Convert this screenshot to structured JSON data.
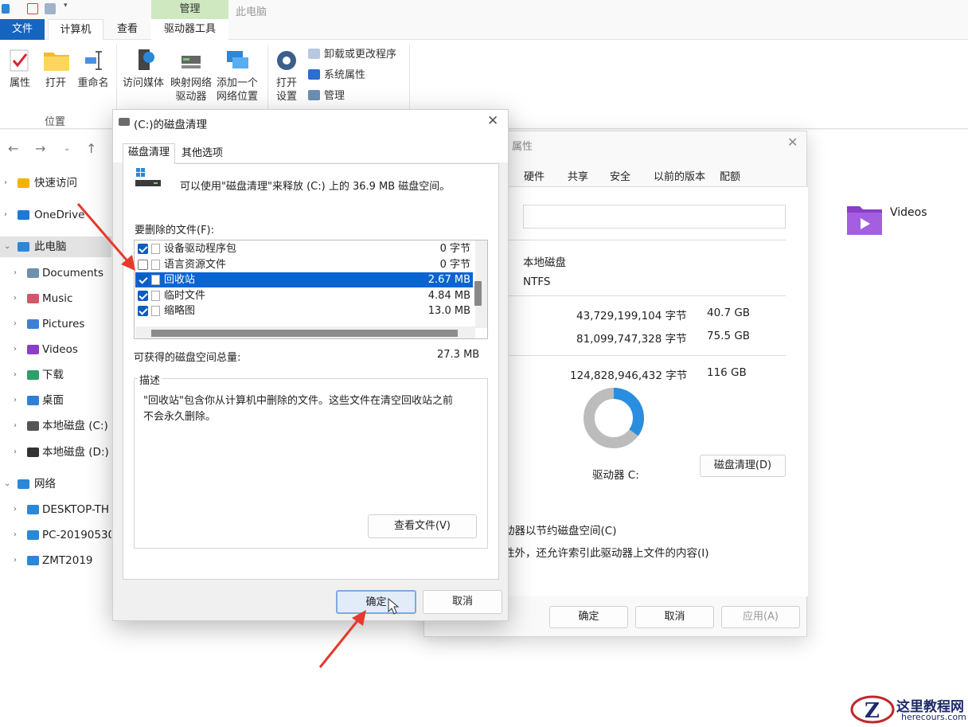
{
  "explorer": {
    "window_title": "此电脑",
    "context_tab": "管理",
    "tabs": {
      "file": "文件",
      "computer": "计算机",
      "view": "查看",
      "drive_tools": "驱动器工具"
    },
    "ribbon": {
      "properties": "属性",
      "open": "打开",
      "rename": "重命名",
      "access_media_l1": "访问媒体",
      "map_drive_l1": "映射网络",
      "map_drive_l2": "驱动器",
      "add_location_l1": "添加一个",
      "add_location_l2": "网络位置",
      "open_settings_l1": "打开",
      "open_settings_l2": "设置",
      "uninstall": "卸载或更改程序",
      "system_props": "系统属性",
      "manage": "管理",
      "group_location": "位置"
    },
    "sidebar": [
      {
        "label": "快速访问",
        "chevron": "›",
        "icon": "star-icon",
        "color": "#f2b300"
      },
      {
        "label": "OneDrive",
        "chevron": "›",
        "icon": "cloud-icon",
        "color": "#1e78d7"
      },
      {
        "label": "此电脑",
        "chevron": "⌄",
        "icon": "pc-icon",
        "color": "#2b87d8"
      },
      {
        "label": "Documents",
        "chevron": "›",
        "icon": "documents-folder-icon",
        "color": "#6d8fb0"
      },
      {
        "label": "Music",
        "chevron": "›",
        "icon": "music-folder-icon",
        "color": "#d4566b"
      },
      {
        "label": "Pictures",
        "chevron": "›",
        "icon": "pictures-folder-icon",
        "color": "#3d7fd6"
      },
      {
        "label": "Videos",
        "chevron": "›",
        "icon": "videos-folder-icon",
        "color": "#8a3fc8"
      },
      {
        "label": "下载",
        "chevron": "›",
        "icon": "downloads-folder-icon",
        "color": "#2e9e6b"
      },
      {
        "label": "桌面",
        "chevron": "›",
        "icon": "desktop-folder-icon",
        "color": "#2f7fd8"
      },
      {
        "label": "本地磁盘 (C:)",
        "chevron": "›",
        "icon": "drive-c-icon",
        "color": "#555555"
      },
      {
        "label": "本地磁盘 (D:)",
        "chevron": "›",
        "icon": "drive-d-icon",
        "color": "#333333"
      },
      {
        "label": "网络",
        "chevron": "⌄",
        "icon": "network-icon",
        "color": "#2b87d8"
      },
      {
        "label": "DESKTOP-TH",
        "chevron": "›",
        "icon": "computer-icon",
        "color": "#2b87d8"
      },
      {
        "label": "PC-20190530",
        "chevron": "›",
        "icon": "computer-icon",
        "color": "#2b87d8"
      },
      {
        "label": "ZMT2019",
        "chevron": "›",
        "icon": "computer-icon",
        "color": "#2b87d8"
      }
    ],
    "content": {
      "videos_label": "Videos"
    }
  },
  "properties_dialog": {
    "title": "属性",
    "tabs": [
      "硬件",
      "共享",
      "安全",
      "以前的版本",
      "配额"
    ],
    "type_value": "本地磁盘",
    "fs_value": "NTFS",
    "used_bytes": "43,729,199,104 字节",
    "used_gb": "40.7 GB",
    "free_bytes": "81,099,747,328 字节",
    "free_gb": "75.5 GB",
    "used_suffix": ":",
    "free_suffix": ":",
    "capacity_bytes": "124,828,946,432 字节",
    "capacity_gb": "116 GB",
    "drive_label": "驱动器 C:",
    "cleanup_button": "磁盘清理(D)",
    "compress_text": "动器以节约磁盘空间(C)",
    "index_text": "性外，还允许索引此驱动器上文件的内容(I)",
    "ok": "确定",
    "cancel": "取消",
    "apply": "应用(A)",
    "used_fraction": 0.35,
    "used_color": "#2a8ee0",
    "free_color": "#bcbcbc"
  },
  "cleanup_dialog": {
    "title": "(C:)的磁盘清理",
    "tab_active": "磁盘清理",
    "tab_other": "其他选项",
    "intro": "可以使用\"磁盘清理\"来释放  (C:) 上的 36.9 MB 磁盘空间。",
    "files_label": "要删除的文件(F):",
    "files": [
      {
        "name": "设备驱动程序包",
        "size": "0 字节",
        "checked": true,
        "selected": false
      },
      {
        "name": "语言资源文件",
        "size": "0 字节",
        "checked": false,
        "selected": false
      },
      {
        "name": "回收站",
        "size": "2.67 MB",
        "checked": true,
        "selected": true
      },
      {
        "name": "临时文件",
        "size": "4.84 MB",
        "checked": true,
        "selected": false
      },
      {
        "name": "缩略图",
        "size": "13.0 MB",
        "checked": true,
        "selected": false
      }
    ],
    "total_label": "可获得的磁盘空间总量:",
    "total_value": "27.3 MB",
    "description_label": "描述",
    "description_text_1": "\"回收站\"包含你从计算机中删除的文件。这些文件在清空回收站之前",
    "description_text_2": "不会永久删除。",
    "view_files_button": "查看文件(V)",
    "ok": "确定",
    "cancel": "取消",
    "accent": "#0a64d2"
  },
  "watermark": {
    "title": "这里教程网",
    "url": "herecours.com"
  }
}
